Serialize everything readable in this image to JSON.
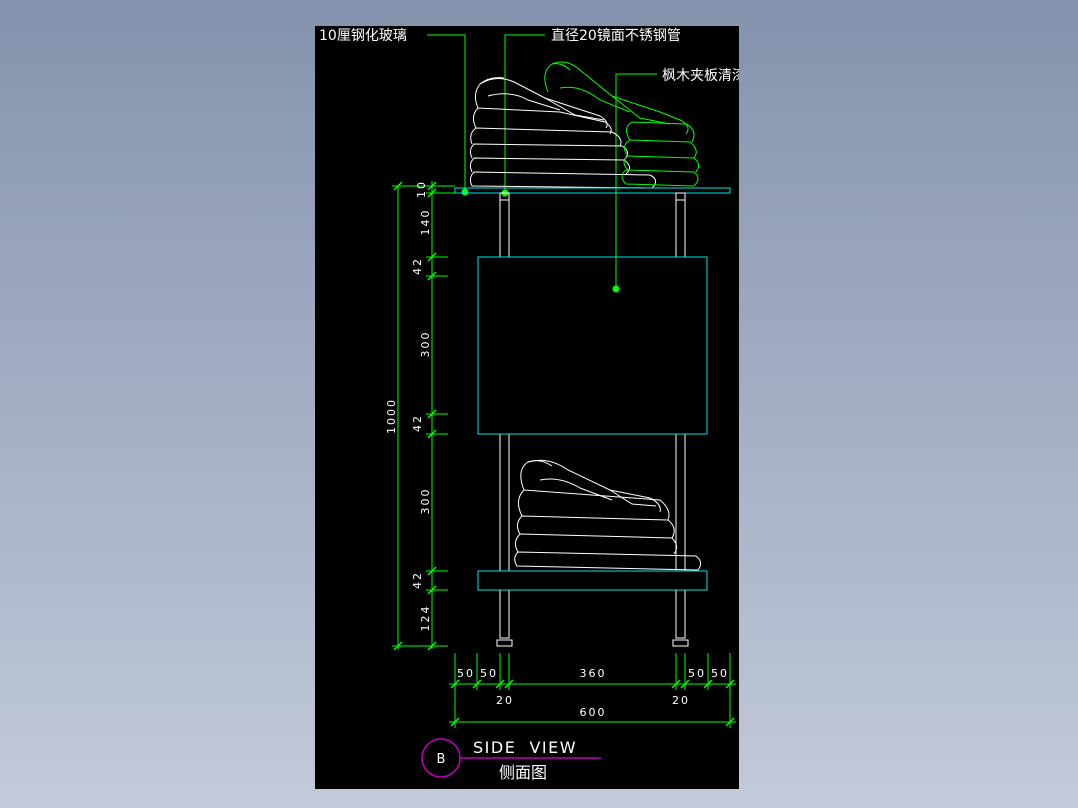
{
  "drawing": {
    "callouts": {
      "glass": "10厘钢化玻璃",
      "tube": "直径20镜面不锈钢管",
      "panel": "枫木夹板清漆"
    },
    "vertical_dims": {
      "d10": "10",
      "d140": "140",
      "d42a": "42",
      "d300a": "300",
      "d42b": "42",
      "d300b": "300",
      "d42c": "42",
      "d124": "124",
      "total": "1000"
    },
    "horizontal_dims": {
      "h50a": "50",
      "h50b": "50",
      "h360": "360",
      "h50c": "50",
      "h50d": "50",
      "h20a": "20",
      "h20b": "20",
      "h600": "600"
    },
    "title": {
      "marker": "B",
      "name": "SIDE  VIEW",
      "subtitle": "侧面图"
    },
    "colors": {
      "background": "#000000",
      "dimension": "#00ff00",
      "cyan": "#00e5e5",
      "garment_green": "#00ff00",
      "garment_white": "#ffffff",
      "title_line": "#c000c0"
    }
  }
}
